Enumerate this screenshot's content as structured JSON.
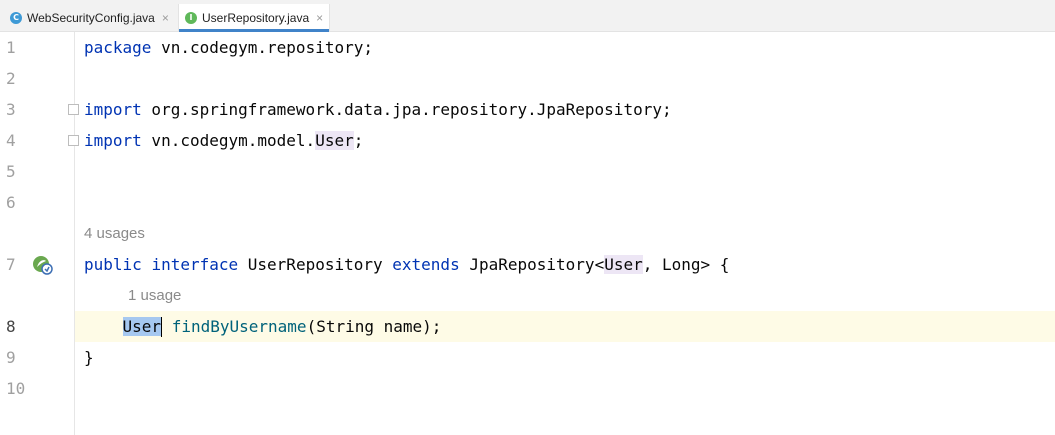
{
  "tabs": [
    {
      "label": "WebSecurityConfig.java",
      "icon": "java-class-icon",
      "icon_letter": "C",
      "active": false
    },
    {
      "label": "UserRepository.java",
      "icon": "java-interface-icon",
      "icon_letter": "I",
      "active": true
    }
  ],
  "tab_close_glyph": "×",
  "line_numbers": [
    "1",
    "2",
    "3",
    "4",
    "5",
    "6",
    "7",
    "8",
    "9",
    "10"
  ],
  "current_line": "8",
  "inlay_hints": {
    "interface_usages": "4 usages",
    "method_usages": "1 usage"
  },
  "code": {
    "line1": {
      "kw": "package",
      "rest": " vn.codegym.repository;"
    },
    "line3": {
      "kw": "import",
      "rest": " org.springframework.data.jpa.repository.JpaRepository;"
    },
    "line4": {
      "kw": "import",
      "pre": " vn.codegym.model.",
      "hl": "User",
      "post": ";"
    },
    "line7": {
      "kw1": "public",
      "kw2": "interface",
      "name": " UserRepository ",
      "kw3": "extends",
      "pre": " JpaRepository<",
      "hl": "User",
      "post": ", Long> {"
    },
    "line8": {
      "indent": "    ",
      "sel": "User",
      "space": " ",
      "fn": "findByUsername",
      "rest": "(String name);"
    },
    "line9": {
      "text": "}"
    }
  },
  "colors": {
    "keyword": "#0033b3",
    "method": "#00627a",
    "selection": "#a6c8f0",
    "usage_highlight": "#ede6f5",
    "current_line": "#fefbe6",
    "active_tab_underline": "#4083c9"
  }
}
